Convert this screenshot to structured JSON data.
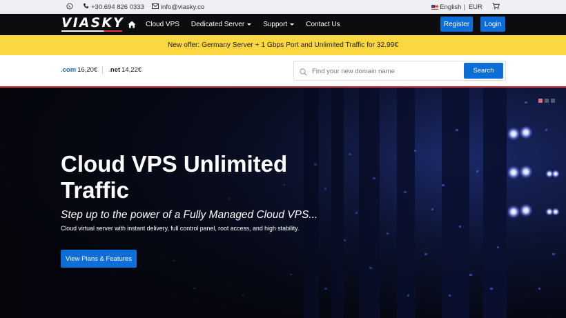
{
  "topbar": {
    "whatsapp_icon": "whatsapp-icon",
    "phone": "+30.694 826 0333",
    "email": "info@viasky.co",
    "language": "English",
    "currency": "EUR",
    "cart_icon": "cart-icon"
  },
  "navbar": {
    "logo": "VIASKY",
    "home_icon": "home-icon",
    "links": [
      "Cloud VPS",
      "Dedicated Server",
      "Support",
      "Contact Us"
    ],
    "register": "Register",
    "login": "Login"
  },
  "promo": {
    "text": "New offer: Germany Server + 1 Gbps Port and Unlimited Traffic for 32.99€"
  },
  "domain": {
    "com_tld": "com",
    "com_price": "16,20€",
    "net_tld": "net",
    "net_price": "14,22€",
    "search_placeholder": "Find your new domain name",
    "search_button": "Search"
  },
  "hero": {
    "title": "Cloud VPS Unlimited Traffic",
    "subtitle": "Step up to the power of a Fully Managed Cloud VPS...",
    "description": "Cloud virtual server with instant delivery, full control panel, root access, and high stability.",
    "cta": "View Plans & Features",
    "slide_count": 3,
    "active_slide": 1
  },
  "colors": {
    "accent_blue": "#0d6ed8",
    "promo_yellow": "#fbd741",
    "navbar_black": "#0d0d0f",
    "red_line": "#d9333b"
  }
}
